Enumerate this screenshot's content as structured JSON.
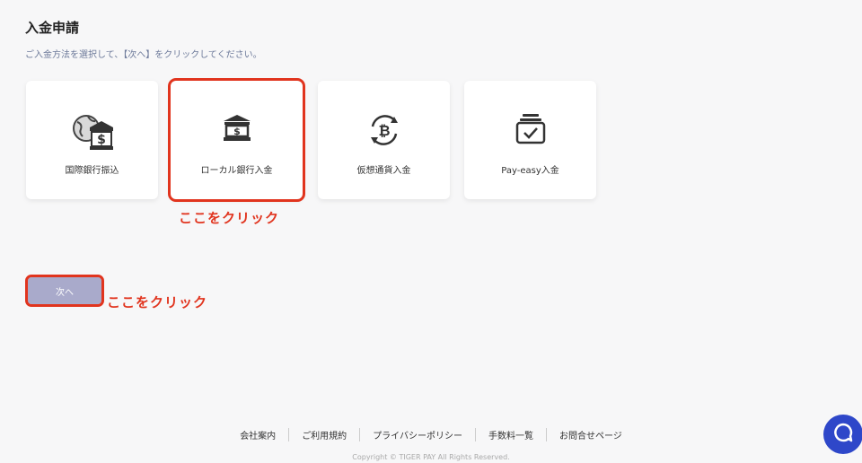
{
  "page": {
    "title": "入金申請",
    "subtitle": "ご入金方法を選択して、【次へ】をクリックしてください。"
  },
  "methods": [
    {
      "label": "国際銀行振込",
      "icon": "globe-bank-icon",
      "selected": false
    },
    {
      "label": "ローカル銀行入金",
      "icon": "bank-icon",
      "selected": true
    },
    {
      "label": "仮想通貨入金",
      "icon": "bitcoin-exchange-icon",
      "selected": false
    },
    {
      "label": "Pay-easy入金",
      "icon": "payeasy-icon",
      "selected": false
    }
  ],
  "annotations": {
    "card_hint": "ここをクリック",
    "button_hint": "ここをクリック"
  },
  "actions": {
    "next_label": "次へ"
  },
  "footer": {
    "links": [
      "会社案内",
      "ご利用規約",
      "プライバシーポリシー",
      "手数料一覧",
      "お問合せページ"
    ],
    "copyright": "Copyright © TIGER PAY All Rights Reserved."
  },
  "colors": {
    "highlight": "#e1341e",
    "button_bg": "#a9aacb",
    "chat_bg": "#2e47c9"
  }
}
